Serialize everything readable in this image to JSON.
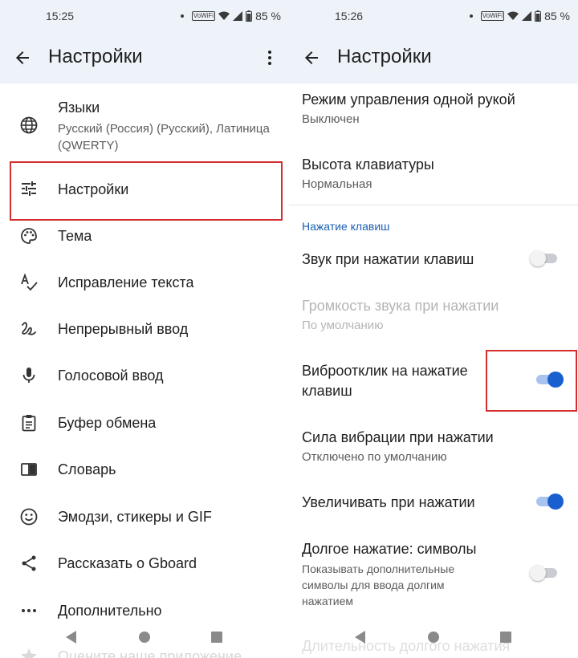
{
  "left": {
    "status": {
      "time": "15:25",
      "battery": "85 %",
      "volte": "VoWiFi"
    },
    "appbar": {
      "title": "Настройки"
    },
    "items": [
      {
        "label": "Языки",
        "sub": "Русский (Россия) (Русский), Латиница (QWERTY)",
        "icon": "language-icon"
      },
      {
        "label": "Настройки",
        "icon": "tune-icon"
      },
      {
        "label": "Тема",
        "icon": "palette-icon"
      },
      {
        "label": "Исправление текста",
        "icon": "spellcheck-icon"
      },
      {
        "label": "Непрерывный ввод",
        "icon": "gesture-icon"
      },
      {
        "label": "Голосовой ввод",
        "icon": "mic-icon"
      },
      {
        "label": "Буфер обмена",
        "icon": "clipboard-icon"
      },
      {
        "label": "Словарь",
        "icon": "dictionary-icon"
      },
      {
        "label": "Эмодзи, стикеры и GIF",
        "icon": "emoji-icon"
      },
      {
        "label": "Рассказать о Gboard",
        "icon": "share-icon"
      },
      {
        "label": "Дополнительно",
        "icon": "more-horiz-icon"
      },
      {
        "label": "Оцените наше приложение",
        "icon": "star-icon"
      }
    ]
  },
  "right": {
    "status": {
      "time": "15:26",
      "battery": "85 %",
      "volte": "VoWiFi"
    },
    "appbar": {
      "title": "Настройки"
    },
    "items": [
      {
        "title": "Режим управления одной рукой",
        "sub": "Выключен"
      },
      {
        "title": "Высота клавиатуры",
        "sub": "Нормальная"
      }
    ],
    "section": "Нажатие клавиш",
    "key_items": [
      {
        "title": "Звук при нажатии клавиш",
        "toggle": false
      },
      {
        "title": "Громкость звука при нажатии",
        "sub": "По умолчанию",
        "disabled": true
      },
      {
        "title": "Виброотклик на нажатие",
        "title2": "клавиш",
        "toggle": true
      },
      {
        "title": "Сила вибрации при нажатии",
        "sub": "Отключено по умолчанию"
      },
      {
        "title": "Увеличивать при нажатии",
        "toggle": true
      },
      {
        "title": "Долгое нажатие: символы",
        "sub": "Показывать дополнительные",
        "sub2": "символы для ввода долгим",
        "sub3": "нажатием",
        "toggle": false
      },
      {
        "title": "Длительность долгого нажатия",
        "disabled": true
      }
    ]
  },
  "colors": {
    "accent": "#1a5fd0",
    "highlight": "#d32f2f",
    "header_bg": "#eef2f9"
  }
}
